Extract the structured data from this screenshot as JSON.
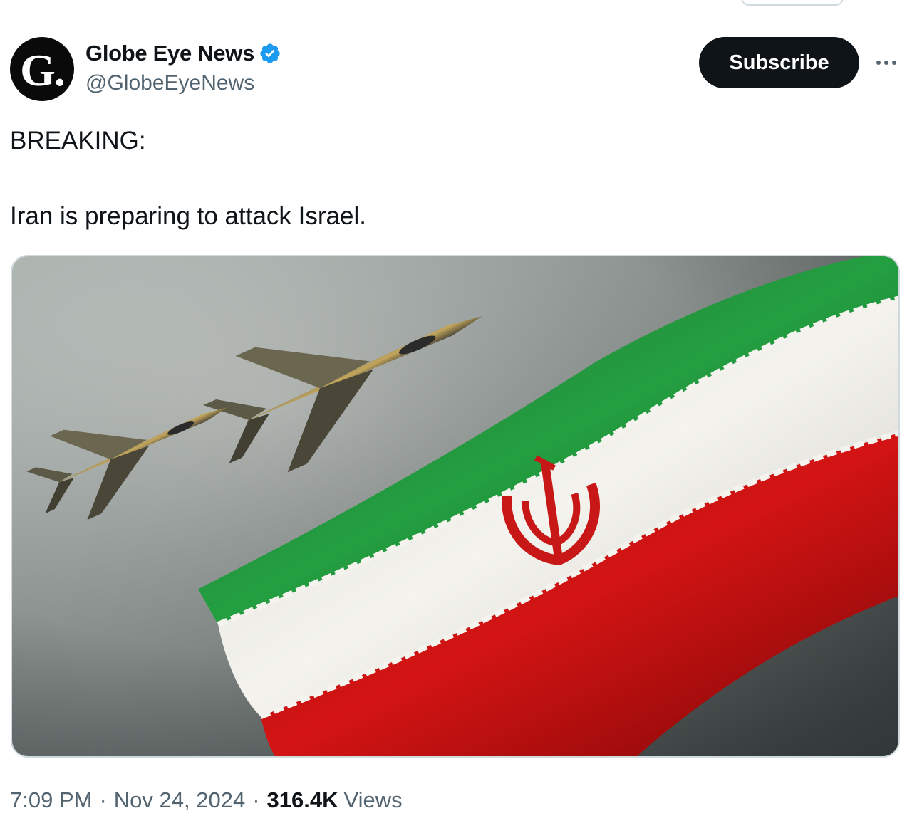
{
  "author": {
    "display_name": "Globe Eye News",
    "handle": "@GlobeEyeNews",
    "avatar_letter": "G.",
    "verified": true,
    "verified_color": "#1d9bf0"
  },
  "actions": {
    "subscribe_label": "Subscribe",
    "more_icon": "more-horizontal-icon"
  },
  "tweet": {
    "line1": "BREAKING:",
    "line2": "Iran is preparing to attack Israel."
  },
  "media": {
    "flag_colors": {
      "green": "#239f40",
      "white": "#f2f2ef",
      "red": "#da0000"
    }
  },
  "meta": {
    "time": "7:09 PM",
    "separator": "·",
    "date": "Nov 24, 2024",
    "views_count": "316.4K",
    "views_label": "Views"
  },
  "colors": {
    "text_primary": "#0f1419",
    "text_secondary": "#536471",
    "subscribe_bg": "#0f1419",
    "border": "#cfd9de"
  }
}
